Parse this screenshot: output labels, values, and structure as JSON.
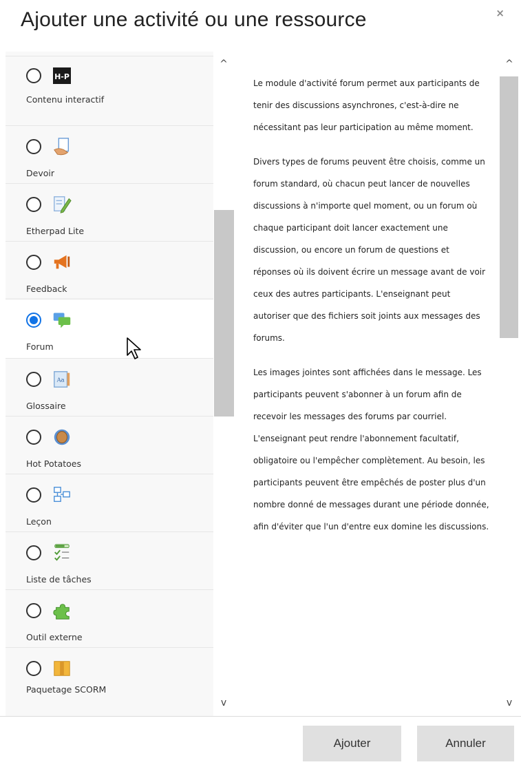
{
  "dialog": {
    "title": "Ajouter une activité ou une ressource",
    "close_glyph": "×"
  },
  "options": [
    {
      "label": "Contenu interactif",
      "icon": "h5p-icon",
      "selected": false
    },
    {
      "label": "Devoir",
      "icon": "assignment-icon",
      "selected": false
    },
    {
      "label": "Etherpad Lite",
      "icon": "etherpad-icon",
      "selected": false
    },
    {
      "label": "Feedback",
      "icon": "megaphone-icon",
      "selected": false
    },
    {
      "label": "Forum",
      "icon": "forum-icon",
      "selected": true
    },
    {
      "label": "Glossaire",
      "icon": "glossary-icon",
      "selected": false
    },
    {
      "label": "Hot Potatoes",
      "icon": "hot-potatoes-icon",
      "selected": false
    },
    {
      "label": "Leçon",
      "icon": "lesson-icon",
      "selected": false
    },
    {
      "label": "Liste de tâches",
      "icon": "checklist-icon",
      "selected": false
    },
    {
      "label": "Outil externe",
      "icon": "puzzle-icon",
      "selected": false
    },
    {
      "label": "Paquetage SCORM",
      "icon": "scorm-package-icon",
      "selected": false
    }
  ],
  "h5p_badge": "H-P",
  "description": {
    "paragraphs": [
      "Le module d'activité forum permet aux participants de tenir des discussions asynchrones, c'est-à-dire ne nécessitant pas leur participation au même moment.",
      "Divers types de forums peuvent être choisis, comme un forum standard, où chacun peut lancer de nouvelles discussions à n'importe quel moment, ou un forum où chaque participant doit lancer exactement une discussion, ou encore un forum de questions et réponses où ils doivent écrire un message avant de voir ceux des autres participants. L'enseignant peut autoriser que des fichiers soit joints aux messages des forums.",
      "Les images jointes sont affichées dans le message. Les participants peuvent s'abonner à un forum afin de recevoir les messages des forums par courriel. L'enseignant peut rendre l'abonnement facultatif, obligatoire ou l'empêcher complètement. Au besoin, les participants peuvent être empêchés de poster plus d'un nombre donné de messages durant une période donnée, afin d'éviter que l'un d'entre eux domine les discussions."
    ]
  },
  "scroll": {
    "up_glyph": "^",
    "down_glyph": "v"
  },
  "footer": {
    "add_label": "Ajouter",
    "cancel_label": "Annuler"
  },
  "colors": {
    "accent": "#1173e6",
    "button_bg": "#e0e0e0",
    "list_bg": "#f8f8f8"
  }
}
